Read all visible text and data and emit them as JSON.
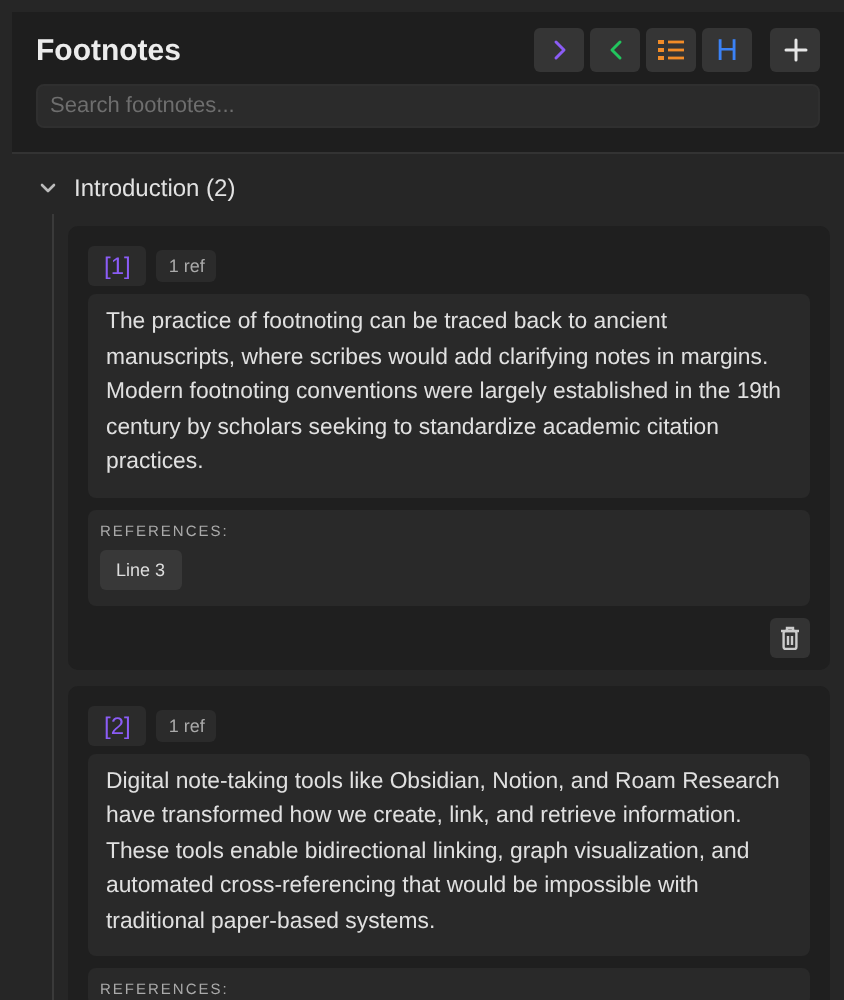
{
  "header": {
    "title": "Footnotes",
    "buttons": [
      {
        "kind": "chevron-right",
        "color": "#8b5cf6"
      },
      {
        "kind": "chevron-left",
        "color": "#22c55e"
      },
      {
        "kind": "list",
        "color": "#f28c28"
      },
      {
        "kind": "text",
        "label": "H",
        "color": "#3b82f6"
      },
      {
        "kind": "plus",
        "color": "#e6e6e6"
      }
    ],
    "search": {
      "placeholder": "Search footnotes..."
    }
  },
  "sections": [
    {
      "title": "Introduction (2)",
      "expanded": true,
      "footnotes": [
        {
          "label": "[1]",
          "ref_count": "1 ref",
          "text": "The practice of footnoting can be traced back to ancient manuscripts, where scribes would add clarifying notes in margins. Modern footnoting conventions were largely established in the 19th century by scholars seeking to standardize academic citation practices.",
          "references_label": "REFERENCES:",
          "references": [
            "Line 3"
          ]
        },
        {
          "label": "[2]",
          "ref_count": "1 ref",
          "text": "Digital note-taking tools like Obsidian, Notion, and Roam Research have transformed how we create, link, and retrieve information. These tools enable bidirectional linking, graph visualization, and automated cross-referencing that would be impossible with traditional paper-based systems.",
          "references_label": "REFERENCES:"
        }
      ]
    }
  ]
}
